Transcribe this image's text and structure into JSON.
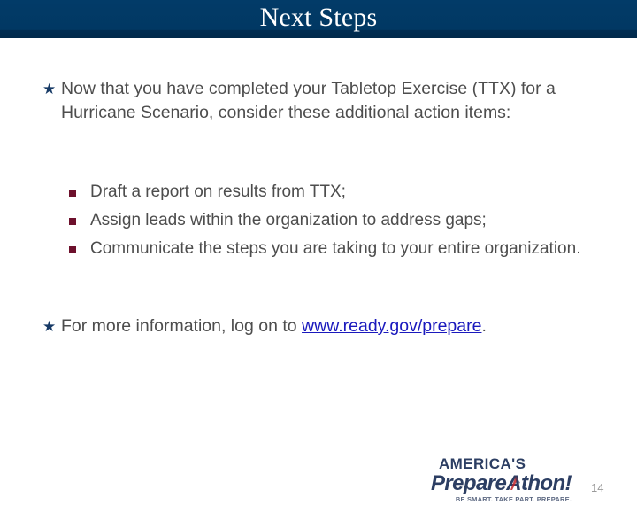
{
  "slide": {
    "title": "Next Steps",
    "page_number": "14",
    "header_color": "#003366",
    "body_text_color": "#4d4d4d",
    "star_bullet_color": "#173a66",
    "square_bullet_color": "#6d102c",
    "link_color": "#1a19bd"
  },
  "bullets": [
    {
      "marker": "star-bullet-icon",
      "marker_glyph": "★",
      "text": "Now that you have completed your Tabletop Exercise (TTX) for a Hurricane Scenario, consider these additional action items:"
    }
  ],
  "sub_bullets": [
    {
      "marker": "square-bullet-icon",
      "text": "Draft a report on results from TTX;"
    },
    {
      "marker": "square-bullet-icon",
      "text": "Assign leads within the organization to address gaps;"
    },
    {
      "marker": "square-bullet-icon",
      "text": "Communicate the steps you are taking to your entire organization."
    }
  ],
  "closing": {
    "marker": "star-bullet-icon",
    "marker_glyph": "★",
    "prefix": "For more information, log on to ",
    "link_text": "www.ready.gov/prepare",
    "suffix": "."
  },
  "logo": {
    "line1": "AMERICA'S",
    "line2_part1": "Prepare",
    "line2_part2": "A",
    "line2_part3": "thon!",
    "tagline": "BE SMART. TAKE PART. PREPARE."
  }
}
